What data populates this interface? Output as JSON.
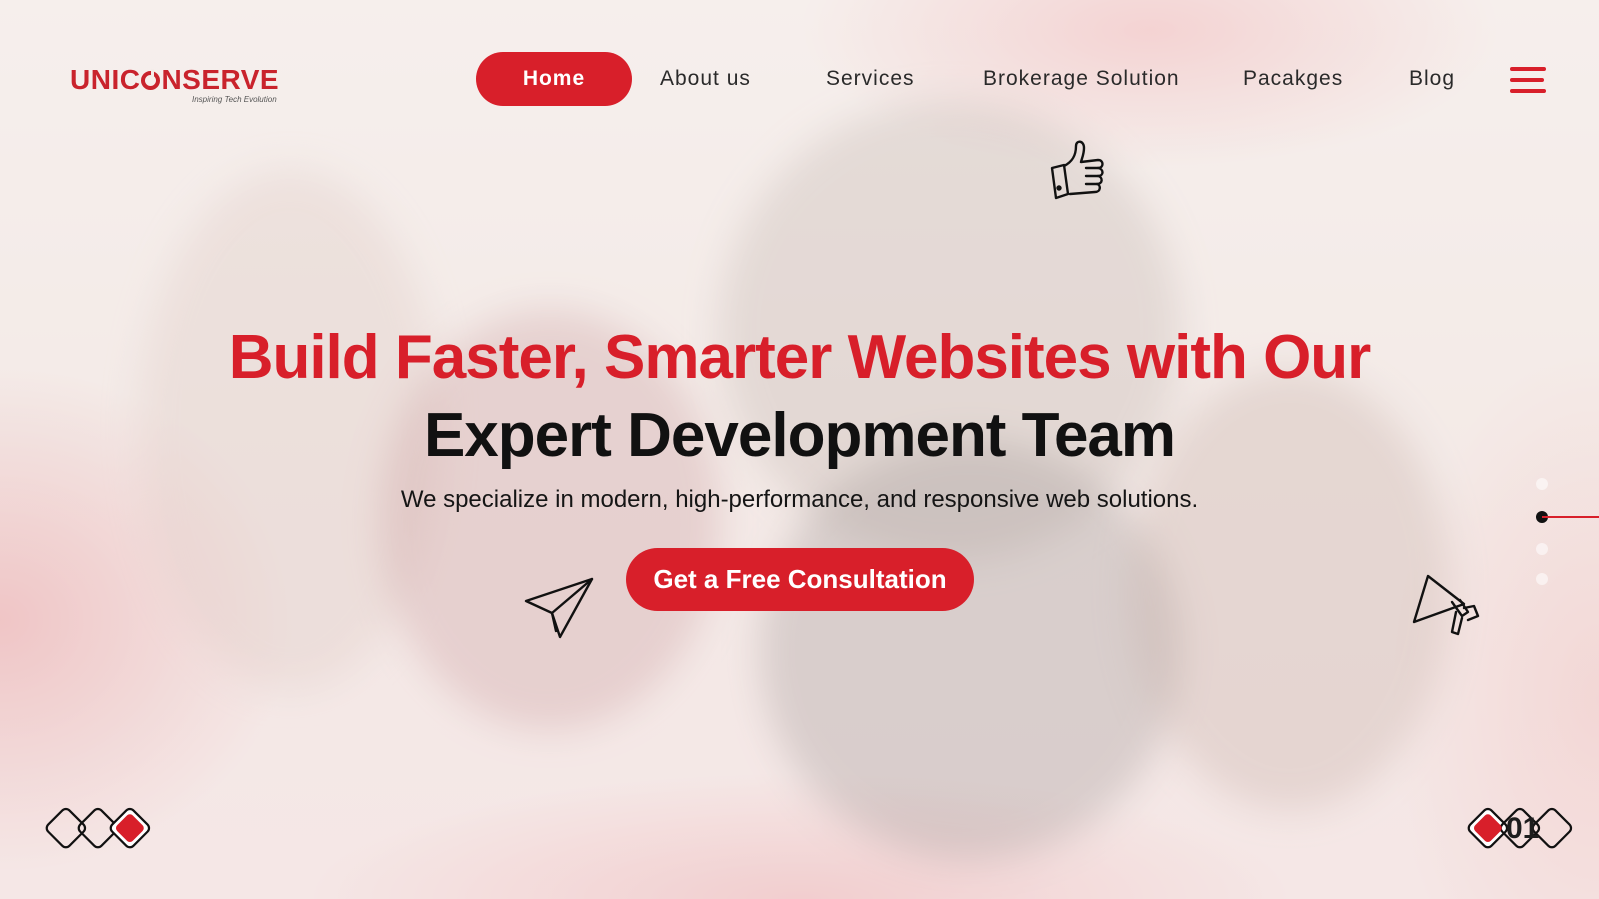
{
  "brand": {
    "name": "UNICONSERVE",
    "tagline": "Inspiring Tech Evolution",
    "color": "#d81f2a"
  },
  "nav": {
    "items": [
      {
        "label": "Home",
        "active": true
      },
      {
        "label": "About us",
        "active": false
      },
      {
        "label": "Services",
        "active": false
      },
      {
        "label": "Brokerage Solution",
        "active": false
      },
      {
        "label": "Pacakges",
        "active": false
      },
      {
        "label": "Blog",
        "active": false
      }
    ],
    "menu_icon": "hamburger-menu-icon"
  },
  "hero": {
    "headline_line1": "Build Faster, Smarter Websites with Our",
    "headline_line2": "Expert Development Team",
    "subheadline": "We specialize in modern, high-performance, and responsive web solutions.",
    "cta_label": "Get a Free Consultation"
  },
  "decor_icons": [
    "thumbs-up-icon",
    "paper-plane-icon",
    "megaphone-icon"
  ],
  "slider": {
    "counter": "01",
    "active_index": 1
  }
}
